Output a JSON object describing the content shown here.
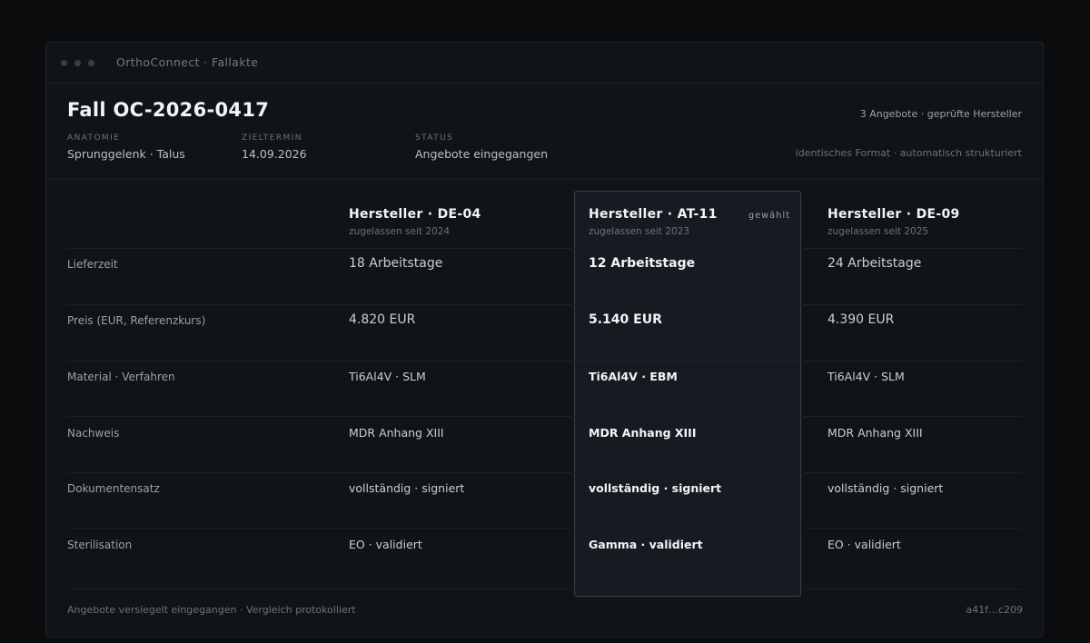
{
  "window": {
    "title": "OrthoConnect · Fallakte"
  },
  "case": {
    "title": "Fall OC-2026-0417",
    "offers_count": "3 Angebote · geprüfte Hersteller",
    "format_note": "identisches Format · automatisch strukturiert",
    "meta": [
      {
        "label": "ANATOMIE",
        "value": "Sprunggelenk · Talus"
      },
      {
        "label": "ZIELTERMIN",
        "value": "14.09.2026"
      },
      {
        "label": "STATUS",
        "value": "Angebote eingegangen"
      }
    ]
  },
  "vendors": [
    {
      "name": "Hersteller · DE-04",
      "since": "zugelassen seit 2024",
      "selected": false
    },
    {
      "name": "Hersteller · AT-11",
      "since": "zugelassen seit 2023",
      "selected": true,
      "selected_label": "gewählt"
    },
    {
      "name": "Hersteller · DE-09",
      "since": "zugelassen seit 2025",
      "selected": false
    }
  ],
  "rows": [
    {
      "label": "Lieferzeit",
      "values": [
        "18 Arbeitstage",
        "12 Arbeitstage",
        "24 Arbeitstage"
      ]
    },
    {
      "label": "Preis (EUR, Referenzkurs)",
      "values": [
        "4.820 EUR",
        "5.140 EUR",
        "4.390 EUR"
      ]
    },
    {
      "label": "Material · Verfahren",
      "values": [
        "Ti6Al4V · SLM",
        "Ti6Al4V · EBM",
        "Ti6Al4V · SLM"
      ]
    },
    {
      "label": "Nachweis",
      "values": [
        "MDR Anhang XIII",
        "MDR Anhang XIII",
        "MDR Anhang XIII"
      ]
    },
    {
      "label": "Dokumentensatz",
      "values": [
        "vollständig · signiert",
        "vollständig · signiert",
        "vollständig · signiert"
      ]
    },
    {
      "label": "Sterilisation",
      "values": [
        "EO · validiert",
        "Gamma · validiert",
        "EO · validiert"
      ]
    }
  ],
  "footer": {
    "left": "Angebote versiegelt eingegangen · Vergleich protokolliert",
    "right": "a41f…c209"
  }
}
